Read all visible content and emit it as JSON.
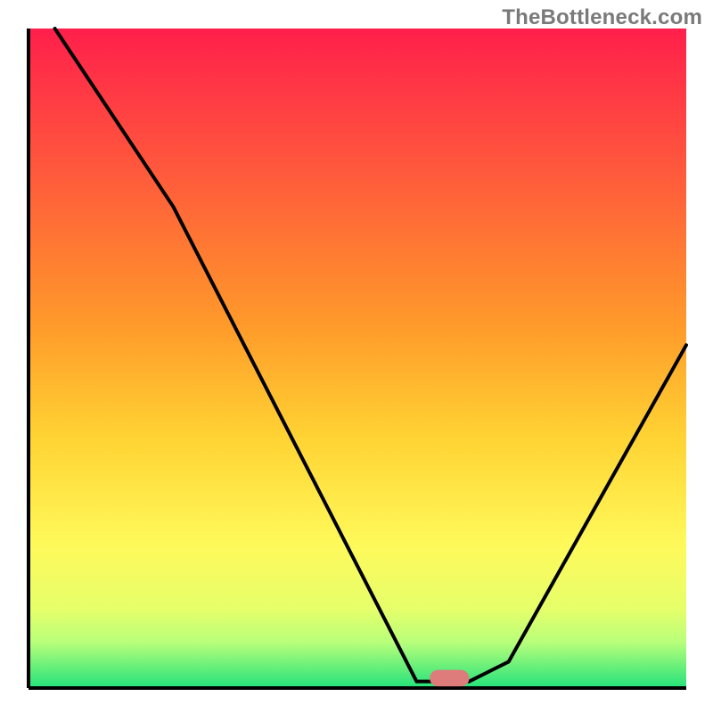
{
  "watermark": "TheBottleneck.com",
  "chart_data": {
    "type": "line",
    "title": "",
    "xlabel": "",
    "ylabel": "",
    "xlim": [
      0,
      100
    ],
    "ylim": [
      0,
      100
    ],
    "background_gradient": {
      "stops": [
        {
          "pct": 0,
          "color": "#ff1f4b"
        },
        {
          "pct": 22,
          "color": "#ff5a3c"
        },
        {
          "pct": 45,
          "color": "#ff9a2a"
        },
        {
          "pct": 62,
          "color": "#ffd333"
        },
        {
          "pct": 78,
          "color": "#fff95a"
        },
        {
          "pct": 88,
          "color": "#e6ff6a"
        },
        {
          "pct": 93,
          "color": "#b9ff7a"
        },
        {
          "pct": 100,
          "color": "#23e27b"
        }
      ]
    },
    "series": [
      {
        "name": "bottleneck-curve",
        "x": [
          4,
          22,
          59,
          67,
          73,
          100
        ],
        "y": [
          100,
          73,
          1,
          1,
          4,
          52
        ]
      }
    ],
    "marker": {
      "name": "optimum-pill",
      "x": 64,
      "y": 1.5,
      "color": "#de7c7c",
      "rx": 4,
      "width": 6,
      "height": 2.5
    },
    "axes": {
      "left": {
        "x": 4,
        "y0": 0,
        "y1": 100
      },
      "bottom": {
        "y": 0,
        "x0": 4,
        "x1": 100
      }
    }
  }
}
